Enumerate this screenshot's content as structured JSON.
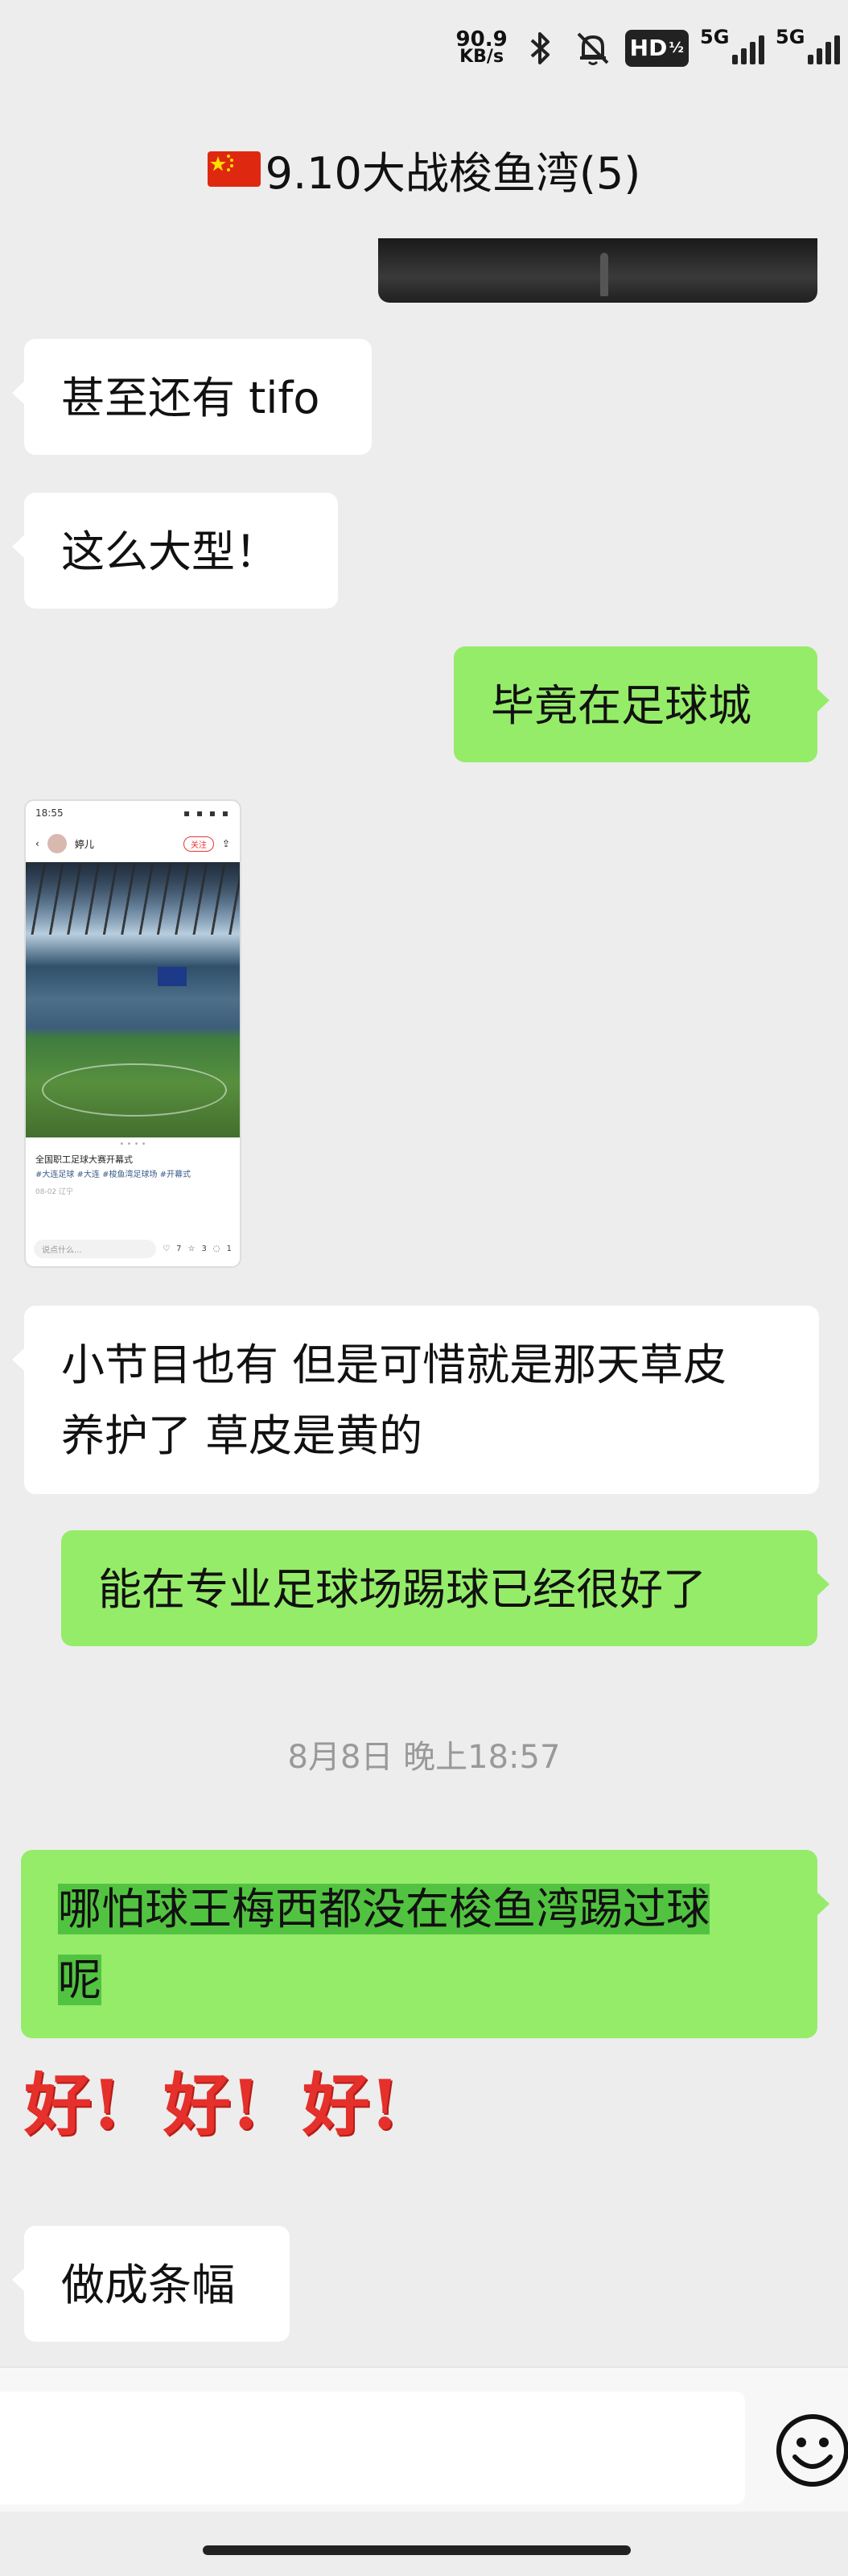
{
  "status_bar": {
    "net_speed_value": "90.9",
    "net_speed_unit": "KB/s",
    "hd_label": "HD",
    "sim1_label": "5G",
    "sim2_label": "5G",
    "icons": [
      "bluetooth-icon",
      "mute-bell-icon",
      "hd-call-icon",
      "signal-icon",
      "signal-icon"
    ]
  },
  "header": {
    "flag_icon": "china-flag-icon",
    "title": "9.10大战梭鱼湾(5)"
  },
  "messages": [
    {
      "side": "right",
      "type": "image",
      "description_icon": "image-thumbnail"
    },
    {
      "side": "left",
      "type": "text",
      "text": "甚至还有 tifo"
    },
    {
      "side": "left",
      "type": "text",
      "text": "这么大型！"
    },
    {
      "side": "right",
      "type": "text",
      "text": "毕竟在足球城"
    },
    {
      "side": "left",
      "type": "image",
      "screenshot": {
        "time": "18:55",
        "author": "婷儿",
        "follow": "关注",
        "dots": "• • • •",
        "caption": "全国职工足球大赛开幕式",
        "tags": "#大连足球 #大连 #梭鱼湾足球场 #开幕式",
        "date": "08-02 辽宁",
        "comment_placeholder": "说点什么...",
        "likes": "7",
        "stars": "3",
        "comments": "1"
      }
    },
    {
      "side": "left",
      "type": "text",
      "lines": [
        "小节目也有 但是可惜就是那天草皮",
        "养护了 草皮是黄的"
      ]
    },
    {
      "side": "right",
      "type": "text",
      "text": "能在专业足球场踢球已经很好了"
    }
  ],
  "timestamp": "8月8日 晚上18:57",
  "messages_after": [
    {
      "side": "right",
      "type": "text",
      "lines": [
        "哪怕球王梅西都没在梭鱼湾踢过球",
        "呢"
      ],
      "highlighted": true
    },
    {
      "side": "left",
      "type": "sticker",
      "words": [
        "好!",
        "好!",
        "好!"
      ]
    },
    {
      "side": "left",
      "type": "text",
      "text": "做成条幅"
    }
  ],
  "input_bar": {
    "placeholder": "",
    "emoji_button_icon": "emoji-face-icon"
  },
  "colors": {
    "background": "#ededed",
    "bubble_sent": "#95ec69",
    "bubble_received": "#ffffff",
    "highlight": "#52c340",
    "sticker_red": "#e5302b"
  }
}
